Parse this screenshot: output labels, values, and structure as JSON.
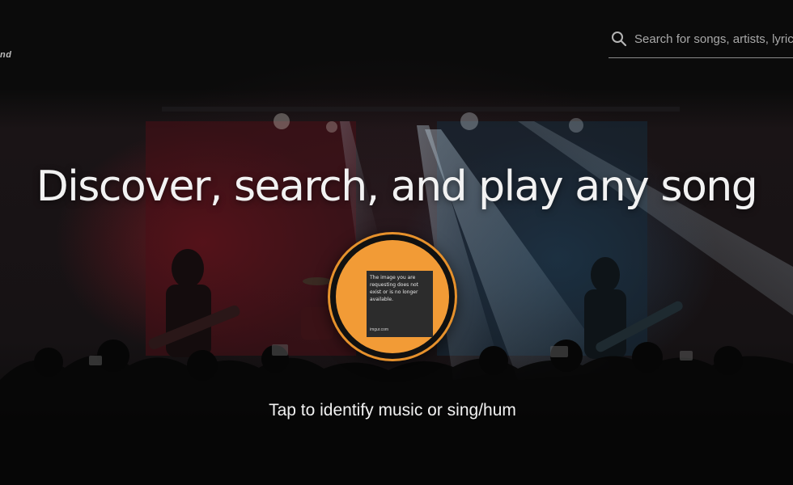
{
  "header": {
    "logo_text": "nd",
    "search": {
      "placeholder": "Search for songs, artists, lyrics"
    }
  },
  "hero": {
    "title": "Discover, search, and play any song",
    "identify_button": {
      "placeholder_text": "The image you are requesting does not exist or is no longer available.",
      "placeholder_caption": "imgur.com"
    },
    "caption": "Tap to identify music or sing/hum"
  },
  "colors": {
    "accent": "#f29b36",
    "background": "#0b0b0b",
    "text": "#f2f2f2"
  },
  "icons": {
    "search": "search-icon"
  }
}
